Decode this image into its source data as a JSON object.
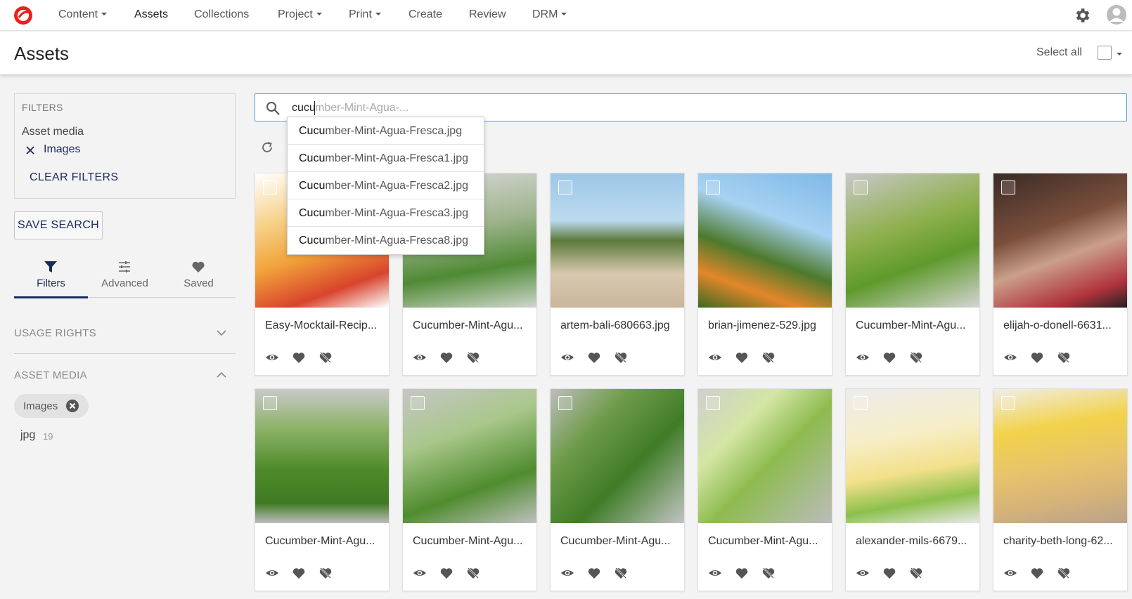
{
  "nav": {
    "items": [
      {
        "label": "Content",
        "dropdown": true
      },
      {
        "label": "Assets",
        "dropdown": false,
        "active": true
      },
      {
        "label": "Collections",
        "dropdown": false
      },
      {
        "label": "Project",
        "dropdown": true
      },
      {
        "label": "Print",
        "dropdown": true
      },
      {
        "label": "Create",
        "dropdown": false
      },
      {
        "label": "Review",
        "dropdown": false
      },
      {
        "label": "DRM",
        "dropdown": true
      }
    ],
    "accent": "#e8221b"
  },
  "header": {
    "title": "Assets",
    "select_all": "Select all"
  },
  "sidebar": {
    "filters_title": "FILTERS",
    "active_group": "Asset media",
    "active_chip": "Images",
    "clear": "CLEAR FILTERS",
    "save_search": "SAVE SEARCH",
    "tabs": [
      {
        "label": "Filters",
        "icon": "filter-icon",
        "active": true
      },
      {
        "label": "Advanced",
        "icon": "sliders-icon"
      },
      {
        "label": "Saved",
        "icon": "heart-icon"
      }
    ],
    "sections": [
      {
        "title": "USAGE RIGHTS",
        "expanded": false
      },
      {
        "title": "ASSET MEDIA",
        "expanded": true
      }
    ],
    "media_chip": "Images",
    "facet": {
      "label": "jpg",
      "count": "19"
    }
  },
  "search": {
    "typed": "cucu",
    "ghost": "mber-Mint-Agua-...",
    "suggestions": [
      {
        "match": "Cucu",
        "rest": "mber-Mint-Agua-Fresca.jpg"
      },
      {
        "match": "Cucu",
        "rest": "mber-Mint-Agua-Fresca1.jpg"
      },
      {
        "match": "Cucu",
        "rest": "mber-Mint-Agua-Fresca2.jpg"
      },
      {
        "match": "Cucu",
        "rest": "mber-Mint-Agua-Fresca3.jpg"
      },
      {
        "match": "Cucu",
        "rest": "mber-Mint-Agua-Fresca8.jpg"
      }
    ]
  },
  "assets": [
    {
      "name": "Easy-Mocktail-Recip...",
      "bg": "linear-gradient(160deg,#ffffff 0%,#f6d28a 30%,#f2a23a 55%,#d8442c 80%,#fff 100%)"
    },
    {
      "name": "Cucumber-Mint-Agu...",
      "bg": "linear-gradient(170deg,#d9d9d9 0%,#9fb48e 40%,#4f8a35 70%,#cfd6cc 100%)"
    },
    {
      "name": "artem-bali-680663.jpg",
      "bg": "linear-gradient(180deg,#9cc7e6 0%,#bcdaf0 35%,#5c7a3a 50%,#d8c9b0 75%,#c9b59a 100%)"
    },
    {
      "name": "brian-jimenez-529.jpg",
      "bg": "linear-gradient(200deg,#7fb8e8 0%,#a7d2f2 35%,#4d7a2c 60%,#e3862a 80%,#3c6a22 100%)"
    },
    {
      "name": "Cucumber-Mint-Agu...",
      "bg": "linear-gradient(160deg,#c8c8c8 0%,#8fb04e 40%,#5f9a2c 65%,#d5d5d5 100%)"
    },
    {
      "name": "elijah-o-donell-6631...",
      "bg": "linear-gradient(160deg,#3a2a26 0%,#7a4f3c 40%,#caa08a 60%,#b0323c 85%,#222 100%)"
    },
    {
      "name": "Cucumber-Mint-Agu...",
      "bg": "linear-gradient(180deg,#c9c9c9 0%,#8bb266 30%,#4e8a2a 60%,#3f7a22 85%,#bdbdbd 100%)"
    },
    {
      "name": "Cucumber-Mint-Agu...",
      "bg": "linear-gradient(160deg,#c6c6c6 0%,#a9c78a 35%,#4f8c2e 70%,#bfbfbf 100%)"
    },
    {
      "name": "Cucumber-Mint-Agu...",
      "bg": "linear-gradient(135deg,#bdbdbd 0%,#6f9c4a 30%,#3f7c26 60%,#c3c3c3 100%)"
    },
    {
      "name": "Cucumber-Mint-Agu...",
      "bg": "linear-gradient(135deg,#cfcfcf 0%,#d4e6a4 30%,#8dbb4e 55%,#bcbcbc 100%)"
    },
    {
      "name": "alexander-mils-6679...",
      "bg": "linear-gradient(170deg,#ececec 0%,#f7eec7 35%,#f2e08a 60%,#8cc04c 80%,#e8e8e8 100%)"
    },
    {
      "name": "charity-beth-long-62...",
      "bg": "linear-gradient(170deg,#f0eee6 0%,#f2d24a 30%,#e9c46a 55%,#d4b27a 80%,#b8a28a 100%)"
    }
  ]
}
